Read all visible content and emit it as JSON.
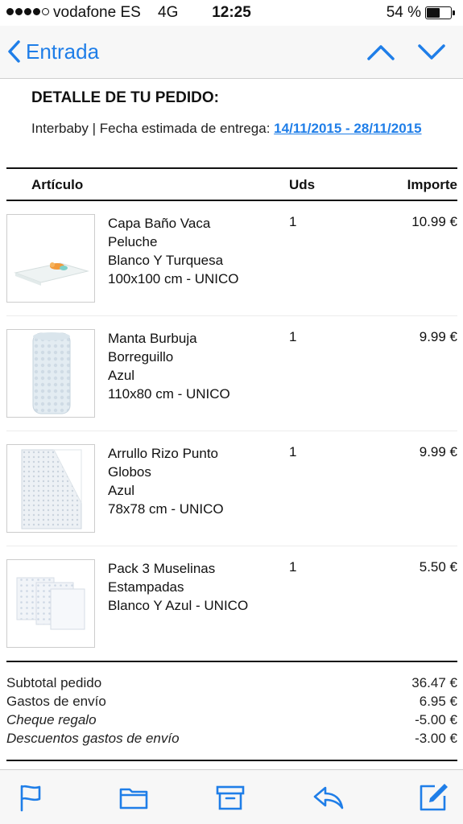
{
  "status_bar": {
    "carrier": "vodafone ES",
    "network": "4G",
    "time": "12:25",
    "battery": "54 %",
    "battery_level": 0.54,
    "signal_bars": 4
  },
  "nav": {
    "back_label": "Entrada",
    "accent_color": "#1f7ee8"
  },
  "order": {
    "title": "DETALLE DE TU PEDIDO:",
    "info_prefix": "Interbaby | Fecha estimada de entrega: ",
    "delivery_dates": "14/11/2015 - 28/11/2015"
  },
  "table": {
    "headers": {
      "article": "Artículo",
      "units": "Uds",
      "amount": "Importe"
    },
    "items": [
      {
        "lines": [
          "Capa Baño Vaca",
          "Peluche",
          "Blanco Y Turquesa",
          "100x100 cm - UNICO"
        ],
        "qty": "1",
        "price": "10.99 €"
      },
      {
        "lines": [
          "Manta Burbuja",
          "Borreguillo",
          "Azul",
          "110x80 cm - UNICO"
        ],
        "qty": "1",
        "price": "9.99 €"
      },
      {
        "lines": [
          "Arrullo Rizo Punto",
          "Globos",
          "Azul",
          "78x78 cm - UNICO"
        ],
        "qty": "1",
        "price": "9.99 €"
      },
      {
        "lines": [
          "Pack 3 Muselinas",
          "Estampadas",
          "Blanco Y Azul - UNICO"
        ],
        "qty": "1",
        "price": "5.50 €"
      }
    ]
  },
  "totals": [
    {
      "label": "Subtotal pedido",
      "value": "36.47 €",
      "italic": false
    },
    {
      "label": "Gastos de envío",
      "value": "6.95 €",
      "italic": false
    },
    {
      "label": "Cheque regalo",
      "value": "-5.00 €",
      "italic": true
    },
    {
      "label": "Descuentos gastos de envío",
      "value": "-3.00 €",
      "italic": true
    }
  ],
  "toolbar": {
    "icons": [
      "flag-icon",
      "folder-icon",
      "archive-icon",
      "reply-icon",
      "compose-icon"
    ]
  }
}
